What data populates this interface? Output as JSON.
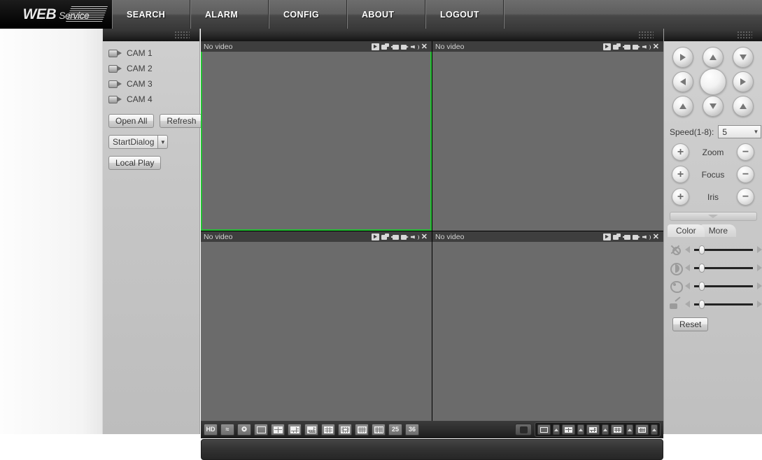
{
  "nav": {
    "logo_main": "WEB",
    "logo_sub": "Service",
    "items": [
      {
        "label": "SEARCH",
        "name": "nav-search"
      },
      {
        "label": "ALARM",
        "name": "nav-alarm"
      },
      {
        "label": "CONFIG",
        "name": "nav-config"
      },
      {
        "label": "ABOUT",
        "name": "nav-about"
      },
      {
        "label": "LOGOUT",
        "name": "nav-logout"
      }
    ]
  },
  "sidebar": {
    "cameras": [
      {
        "label": "CAM 1"
      },
      {
        "label": "CAM 2"
      },
      {
        "label": "CAM 3"
      },
      {
        "label": "CAM 4"
      }
    ],
    "open_all_label": "Open All",
    "refresh_label": "Refresh",
    "dialog_value": "StartDialog",
    "local_play_label": "Local Play"
  },
  "video": {
    "no_video_text": "No video",
    "close_glyph": "✕",
    "cells": [
      {
        "title": "No video",
        "selected": true
      },
      {
        "title": "No video",
        "selected": false
      },
      {
        "title": "No video",
        "selected": false
      },
      {
        "title": "No video",
        "selected": false
      }
    ],
    "title_icons": [
      {
        "name": "record-icon"
      },
      {
        "name": "multi-window-icon"
      },
      {
        "name": "snapshot-icon"
      },
      {
        "name": "local-record-icon"
      },
      {
        "name": "audio-icon"
      }
    ]
  },
  "toolbar": {
    "left_buttons": [
      {
        "name": "hd-quality-button",
        "label": "HD",
        "type": "text"
      },
      {
        "name": "fluency-button",
        "label": "",
        "type": "fluency"
      },
      {
        "name": "fullscreen-button",
        "label": "",
        "type": "fullscreen"
      },
      {
        "name": "split-1-button",
        "label": "1",
        "type": "grid",
        "cols": 1,
        "rows": 1
      },
      {
        "name": "split-4-button",
        "label": "4",
        "type": "grid",
        "cols": 2,
        "rows": 2
      },
      {
        "name": "split-6-button",
        "label": "6",
        "type": "grid",
        "cols": 3,
        "rows": 3
      },
      {
        "name": "split-8-button",
        "label": "8",
        "type": "grid",
        "cols": 4,
        "rows": 3
      },
      {
        "name": "split-9-button",
        "label": "9",
        "type": "grid",
        "cols": 3,
        "rows": 3
      },
      {
        "name": "split-13-button",
        "label": "13",
        "type": "grid",
        "cols": 4,
        "rows": 4
      },
      {
        "name": "split-16-button",
        "label": "16",
        "type": "grid",
        "cols": 4,
        "rows": 4
      },
      {
        "name": "split-20-button",
        "label": "20",
        "type": "grid",
        "cols": 5,
        "rows": 4
      },
      {
        "name": "split-25-button",
        "label": "25",
        "type": "text"
      },
      {
        "name": "split-36-button",
        "label": "36",
        "type": "text"
      }
    ],
    "split_25_label": "25",
    "split_36_label": "36",
    "right_buttons": [
      {
        "name": "layout-1-button",
        "cols": 1,
        "rows": 1
      },
      {
        "name": "layout-4-button",
        "cols": 2,
        "rows": 2
      },
      {
        "name": "layout-6-button",
        "cols": 3,
        "rows": 2
      },
      {
        "name": "layout-9-button",
        "cols": 3,
        "rows": 3
      },
      {
        "name": "layout-16-button",
        "cols": 4,
        "rows": 4
      }
    ],
    "status_text": ""
  },
  "ptz": {
    "directions": [
      {
        "name": "pan-upleft-button",
        "dir": "left"
      },
      {
        "name": "pan-up-button",
        "dir": "up"
      },
      {
        "name": "pan-upright-button",
        "dir": "down"
      },
      {
        "name": "pan-left-button",
        "dir": "left"
      },
      {
        "name": "pan-center-button",
        "dir": "center"
      },
      {
        "name": "pan-right-button",
        "dir": "right"
      },
      {
        "name": "pan-downleft-button",
        "dir": "up"
      },
      {
        "name": "pan-down-button",
        "dir": "down"
      },
      {
        "name": "pan-downright-button",
        "dir": "up"
      }
    ],
    "speed_label": "Speed(1-8):",
    "speed_value": "5",
    "plus_glyph": "+",
    "minus_glyph": "−",
    "zoom_label": "Zoom",
    "focus_label": "Focus",
    "iris_label": "Iris",
    "tabs": [
      {
        "label": "Color",
        "active": true
      },
      {
        "label": "More",
        "active": false
      }
    ],
    "sliders": [
      {
        "name": "brightness-slider",
        "icon": "brightness-icon",
        "value": 8
      },
      {
        "name": "contrast-slider",
        "icon": "contrast-icon",
        "value": 8
      },
      {
        "name": "saturation-slider",
        "icon": "saturation-icon",
        "value": 8
      },
      {
        "name": "sharpness-slider",
        "icon": "sharpness-icon",
        "value": 8
      }
    ],
    "reset_label": "Reset"
  },
  "colors": {
    "selected_border": "#22c032",
    "video_bg": "#6b6b6b",
    "panel_bg": "#c8c8c8",
    "nav_text": "#ffffff"
  }
}
